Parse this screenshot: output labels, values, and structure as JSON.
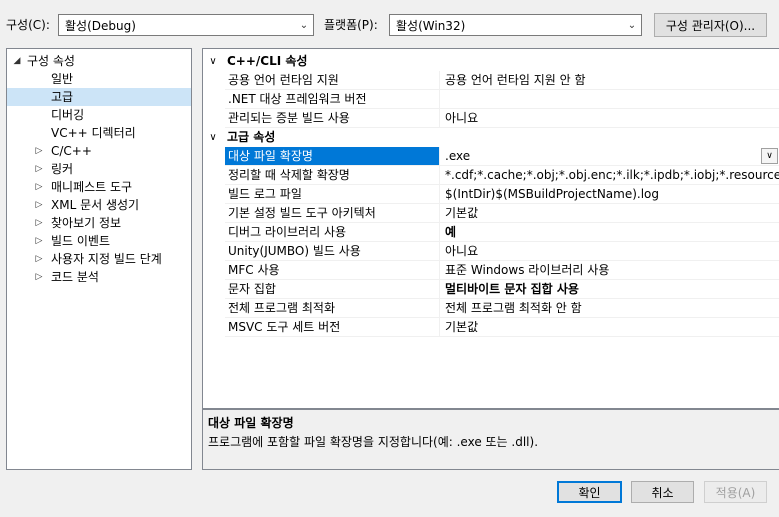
{
  "config": {
    "label": "구성(C):",
    "value": "활성(Debug)"
  },
  "platform": {
    "label": "플랫폼(P):",
    "value": "활성(Win32)"
  },
  "config_manager_button": "구성 관리자(O)...",
  "tree": {
    "root": "구성 속성",
    "items": [
      {
        "label": "일반",
        "expander": false
      },
      {
        "label": "고급",
        "expander": false,
        "selected": true
      },
      {
        "label": "디버깅",
        "expander": false
      },
      {
        "label": "VC++ 디렉터리",
        "expander": false
      },
      {
        "label": "C/C++",
        "expander": true
      },
      {
        "label": "링커",
        "expander": true
      },
      {
        "label": "매니페스트 도구",
        "expander": true
      },
      {
        "label": "XML 문서 생성기",
        "expander": true
      },
      {
        "label": "찾아보기 정보",
        "expander": true
      },
      {
        "label": "빌드 이벤트",
        "expander": true
      },
      {
        "label": "사용자 지정 빌드 단계",
        "expander": true
      },
      {
        "label": "코드 분석",
        "expander": true
      }
    ]
  },
  "grid": {
    "categories": [
      {
        "title": "C++/CLI 속성",
        "rows": [
          {
            "name": "공용 언어 런타임 지원",
            "value": "공용 언어 런타임 지원 안 함"
          },
          {
            "name": ".NET 대상 프레임워크 버전",
            "value": ""
          },
          {
            "name": "관리되는 증분 빌드 사용",
            "value": "아니요"
          }
        ]
      },
      {
        "title": "고급 속성",
        "rows": [
          {
            "name": "대상 파일 확장명",
            "value": ".exe",
            "selected": true
          },
          {
            "name": "정리할 때 삭제할 확장명",
            "value": "*.cdf;*.cache;*.obj;*.obj.enc;*.ilk;*.ipdb;*.iobj;*.resources;*.tlb;*.tli;*.tlh;"
          },
          {
            "name": "빌드 로그 파일",
            "value": "$(IntDir)$(MSBuildProjectName).log"
          },
          {
            "name": "기본 설정 빌드 도구 아키텍처",
            "value": "기본값"
          },
          {
            "name": "디버그 라이브러리 사용",
            "value": "예",
            "bold": true
          },
          {
            "name": "Unity(JUMBO) 빌드 사용",
            "value": "아니요"
          },
          {
            "name": "MFC 사용",
            "value": "표준 Windows 라이브러리 사용"
          },
          {
            "name": "문자 집합",
            "value": "멀티바이트 문자 집합 사용",
            "bold": true
          },
          {
            "name": "전체 프로그램 최적화",
            "value": "전체 프로그램 최적화 안 함"
          },
          {
            "name": "MSVC 도구 세트 버전",
            "value": "기본값"
          }
        ]
      }
    ]
  },
  "description": {
    "title": "대상 파일 확장명",
    "text": "프로그램에 포함할 파일 확장명을 지정합니다(예: .exe 또는 .dll)."
  },
  "buttons": {
    "ok": "확인",
    "cancel": "취소",
    "apply": "적용(A)"
  },
  "icons": {
    "expand": "chevron-right-icon",
    "collapse": "chevron-down-icon",
    "dropdown": "dropdown-arrow-icon"
  },
  "colors": {
    "selection": "#0078d7",
    "tree_selection": "#cce4f7"
  }
}
